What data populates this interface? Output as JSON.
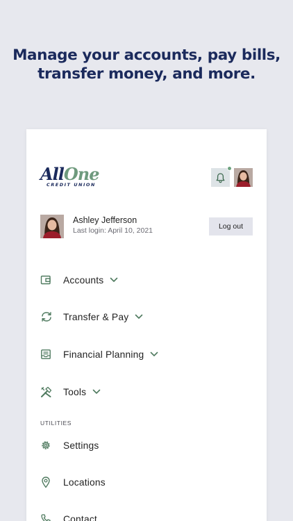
{
  "headline": {
    "line1": "Manage your accounts, pay bills,",
    "line2": "transfer money, and more."
  },
  "logo": {
    "brand_part1": "All",
    "brand_part2": "One",
    "tagline": "CREDIT UNION"
  },
  "header": {
    "notification_icon": "bell-icon",
    "notification_dot_color": "#6da27f"
  },
  "user": {
    "name": "Ashley Jefferson",
    "last_login": "Last login: April 10, 2021",
    "logout_label": "Log out"
  },
  "menu": {
    "items": [
      {
        "label": "Accounts",
        "icon": "wallet-icon",
        "expandable": true
      },
      {
        "label": "Transfer & Pay",
        "icon": "transfer-arrows-icon",
        "expandable": true
      },
      {
        "label": "Financial Planning",
        "icon": "inbox-tray-icon",
        "expandable": true
      },
      {
        "label": "Tools",
        "icon": "tools-icon",
        "expandable": true
      }
    ],
    "utilities_heading": "UTILITIES",
    "utilities": [
      {
        "label": "Settings",
        "icon": "gear-icon"
      },
      {
        "label": "Locations",
        "icon": "map-pin-icon"
      },
      {
        "label": "Contact",
        "icon": "phone-icon"
      }
    ]
  },
  "colors": {
    "navy": "#1b2a5c",
    "accent_green": "#4f7a5f",
    "background": "#e7e8ee"
  }
}
